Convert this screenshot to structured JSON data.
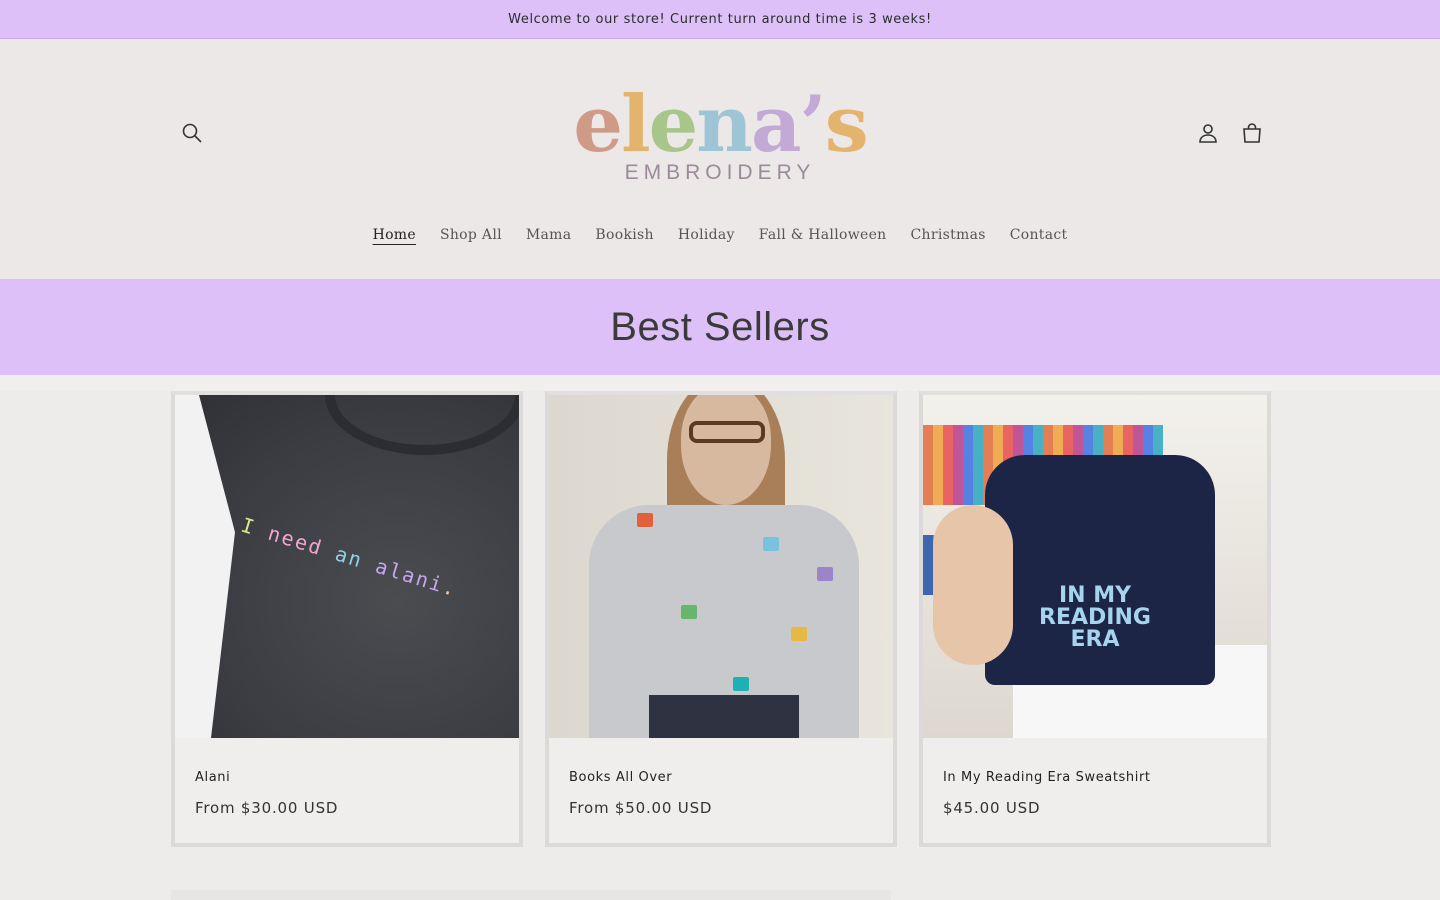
{
  "announcement": {
    "text": "Welcome to our store! Current turn around time is 3 weeks!"
  },
  "header": {
    "logo_letters": [
      "e",
      "l",
      "e",
      "n",
      "a",
      "’",
      "s"
    ],
    "logo_sub": "EMBROIDERY",
    "search_icon": "search-icon",
    "account_icon": "user-icon",
    "cart_icon": "cart-icon"
  },
  "nav": {
    "items": [
      {
        "label": "Home",
        "active": true
      },
      {
        "label": "Shop All"
      },
      {
        "label": "Mama"
      },
      {
        "label": "Bookish"
      },
      {
        "label": "Holiday"
      },
      {
        "label": "Fall & Halloween"
      },
      {
        "label": "Christmas"
      },
      {
        "label": "Contact"
      }
    ]
  },
  "banner": {
    "title": "Best Sellers"
  },
  "products": [
    {
      "title": "Alani",
      "price": "From $30.00 USD",
      "image_text": [
        "I",
        "need",
        "an",
        "alani",
        "."
      ]
    },
    {
      "title": "Books All Over",
      "price": "From $50.00 USD"
    },
    {
      "title": "In My Reading Era Sweatshirt",
      "price": "$45.00 USD",
      "image_text": "IN MY READING ERA"
    }
  ],
  "colors": {
    "accent": "#dcc0f7",
    "page_bg": "#eeeceb"
  }
}
